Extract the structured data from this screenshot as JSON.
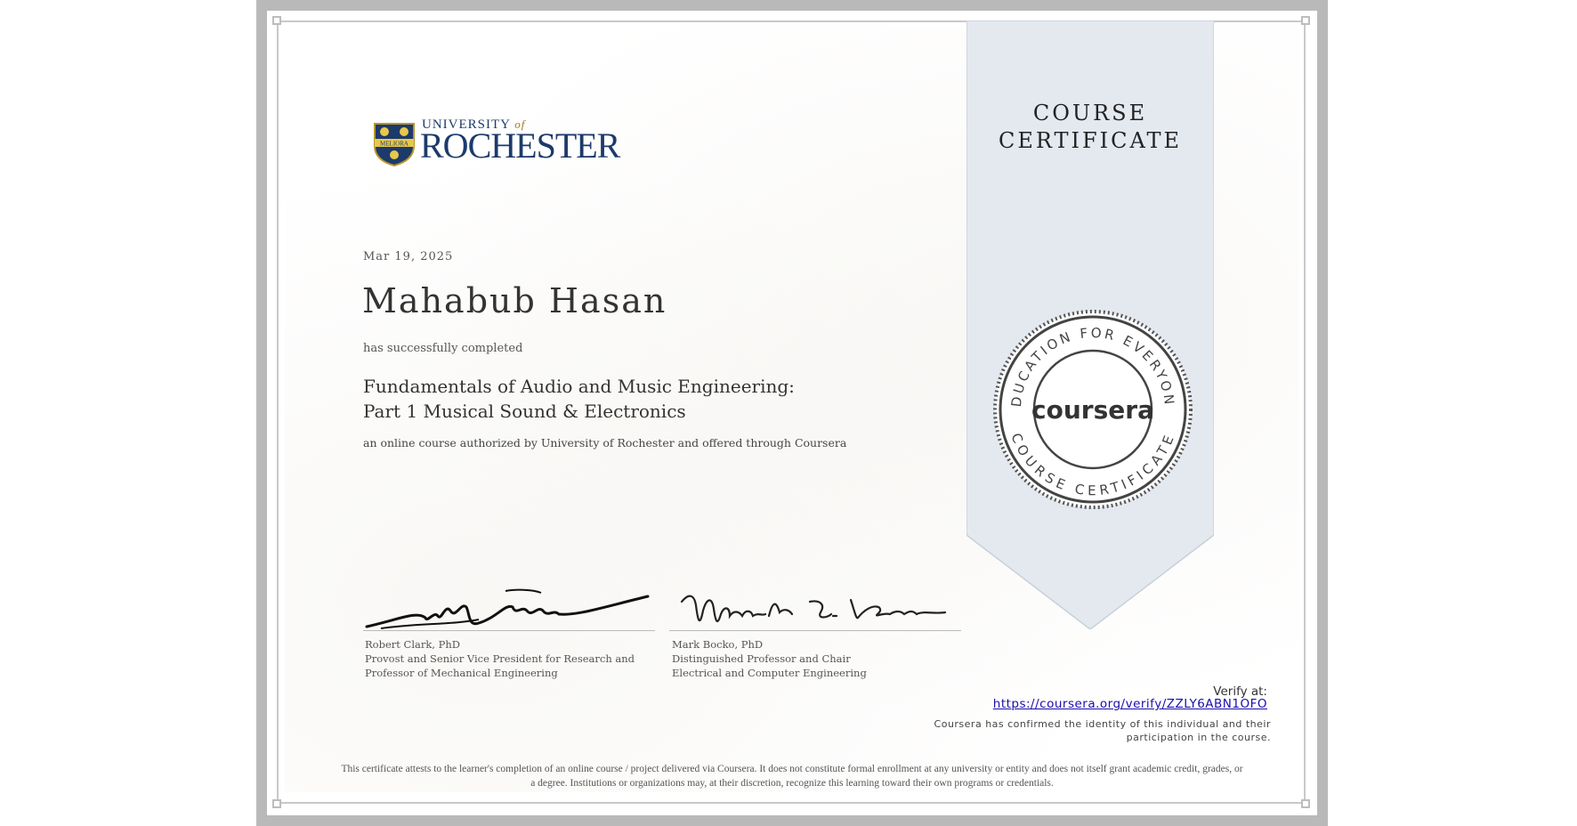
{
  "certificate": {
    "type_label_line1": "COURSE",
    "type_label_line2": "CERTIFICATE",
    "date": "Mar 19, 2025",
    "recipient_name": "Mahabub Hasan",
    "completion_text": "has successfully completed",
    "course_title_line1": "Fundamentals of Audio and Music Engineering:",
    "course_title_line2": "Part 1 Musical Sound & Electronics",
    "authorization_text": "an online course authorized by University of Rochester and offered through Coursera"
  },
  "logo": {
    "small_text": "UNIVERSITY",
    "small_of": "of",
    "big_text": "ROCHESTER",
    "shield_text": "MELIORA"
  },
  "seal": {
    "top_text": "EDUCATION FOR EVERYONE",
    "bottom_text": "COURSE CERTIFICATE",
    "center_text": "coursera"
  },
  "signers": [
    {
      "name": "Robert Clark, PhD",
      "title_line1": "Provost and Senior Vice President for Research and",
      "title_line2": "Professor of Mechanical Engineering"
    },
    {
      "name": "Mark Bocko, PhD",
      "title_line1": "Distinguished Professor and Chair",
      "title_line2": "Electrical and Computer Engineering"
    }
  ],
  "verification": {
    "label": "Verify at:",
    "url": "https://coursera.org/verify/ZZLY6ABN1OFO",
    "identity_line1": "Coursera has confirmed the identity of this individual and their",
    "identity_line2": "participation in the course."
  },
  "disclaimer_line1": "This certificate attests to the learner's completion of an online course / project delivered via Coursera. It does not constitute formal enrollment at any university or entity and does not itself grant academic credit, grades, or",
  "disclaimer_line2": "a degree. Institutions or organizations may, at their discretion, recognize this learning toward their own programs or credentials.",
  "colors": {
    "ribbon": "#e4e9f0",
    "brand_blue": "#1c3a6b",
    "link": "#1a0dab",
    "frame": "#b9b9b9"
  }
}
